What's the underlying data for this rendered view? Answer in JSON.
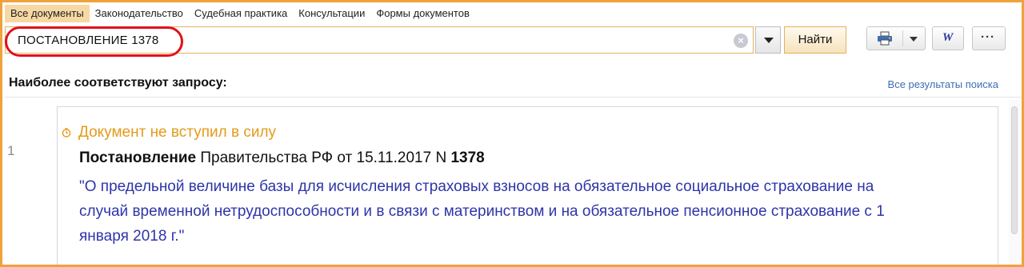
{
  "tabs": [
    {
      "label": "Все документы",
      "active": true
    },
    {
      "label": "Законодательство",
      "active": false
    },
    {
      "label": "Судебная практика",
      "active": false
    },
    {
      "label": "Консультации",
      "active": false
    },
    {
      "label": "Формы документов",
      "active": false
    }
  ],
  "search": {
    "value": "ПОСТАНОВЛЕНИЕ 1378",
    "find_label": "Найти"
  },
  "toolbar": {
    "word_label": "W",
    "more_label": "···"
  },
  "results": {
    "header": "Наиболее соответствуют запросу:",
    "all_results_link": "Все результаты поиска",
    "items": [
      {
        "number": "1",
        "status": "Документ не вступил в силу",
        "doc_type": "Постановление",
        "issuer_date": " Правительства РФ от 15.11.2017 N ",
        "doc_number": "1378",
        "title": "\"О предельной величине базы для исчисления страховых взносов на обязательное социальное страхование на случай временной нетрудоспособности и в связи с материнством и на обязательное пенсионное страхование с 1 января 2018 г.\""
      }
    ]
  },
  "colors": {
    "frame_border": "#f0a23a",
    "active_tab": "#f7d8a4",
    "highlight_oval": "#e0101a",
    "status_text": "#e49a1c",
    "doc_title": "#2e35a8",
    "link": "#3c6fb5"
  },
  "icons": [
    "clear-icon",
    "dropdown-arrow-icon",
    "printer-icon",
    "word-icon",
    "more-icon",
    "clock-icon"
  ]
}
